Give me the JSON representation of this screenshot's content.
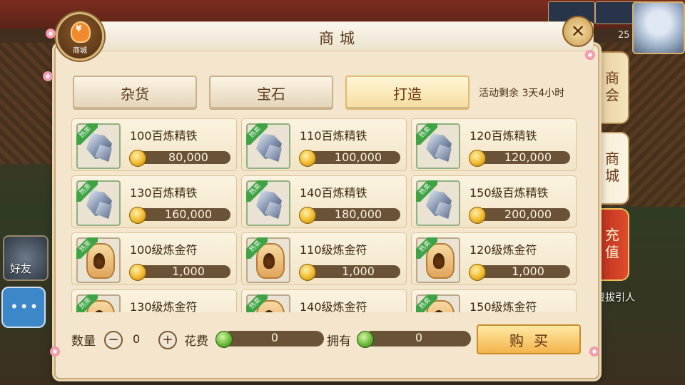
{
  "window": {
    "title": "商城",
    "logo_text": "商城",
    "logo_symbol": "¥"
  },
  "hud": {
    "level": "25",
    "friend_label": "好友",
    "guide_text": "免费拔引人"
  },
  "side_tabs": [
    {
      "label": "商会"
    },
    {
      "label": "商城"
    },
    {
      "label": "充值"
    }
  ],
  "categories": [
    {
      "label": "杂货",
      "active": false
    },
    {
      "label": "宝石",
      "active": false
    },
    {
      "label": "打造",
      "active": true
    }
  ],
  "activity": {
    "text": "活动剩余 3天4小时"
  },
  "badge_text": "热卖",
  "items": [
    {
      "name": "100百炼精铁",
      "price": "80,000",
      "icon": "iron-ore"
    },
    {
      "name": "110百炼精铁",
      "price": "100,000",
      "icon": "iron-ore"
    },
    {
      "name": "120百炼精铁",
      "price": "120,000",
      "icon": "iron-ore"
    },
    {
      "name": "130百炼精铁",
      "price": "160,000",
      "icon": "iron-ore"
    },
    {
      "name": "140百炼精铁",
      "price": "180,000",
      "icon": "iron-ore"
    },
    {
      "name": "150级百炼精铁",
      "price": "200,000",
      "icon": "iron-ore"
    },
    {
      "name": "100级炼金符",
      "price": "1,000",
      "icon": "alchemy-talisman"
    },
    {
      "name": "110级炼金符",
      "price": "1,000",
      "icon": "alchemy-talisman"
    },
    {
      "name": "120级炼金符",
      "price": "1,000",
      "icon": "alchemy-talisman"
    },
    {
      "name": "130级炼金符",
      "price": "",
      "icon": "alchemy-talisman"
    },
    {
      "name": "140级炼金符",
      "price": "",
      "icon": "alchemy-talisman"
    },
    {
      "name": "150级炼金符",
      "price": "",
      "icon": "alchemy-talisman"
    }
  ],
  "purchase": {
    "quantity_label": "数量",
    "quantity": "0",
    "minus": "−",
    "plus": "+",
    "cost_label": "花费",
    "cost": "0",
    "owned_label": "拥有",
    "owned": "0",
    "buy_label": "购买"
  },
  "colors": {
    "panel": "#f3e6cd",
    "price_bar": "#6a5236",
    "hot_badge": "#3fa345",
    "recharge": "#d33a24"
  }
}
